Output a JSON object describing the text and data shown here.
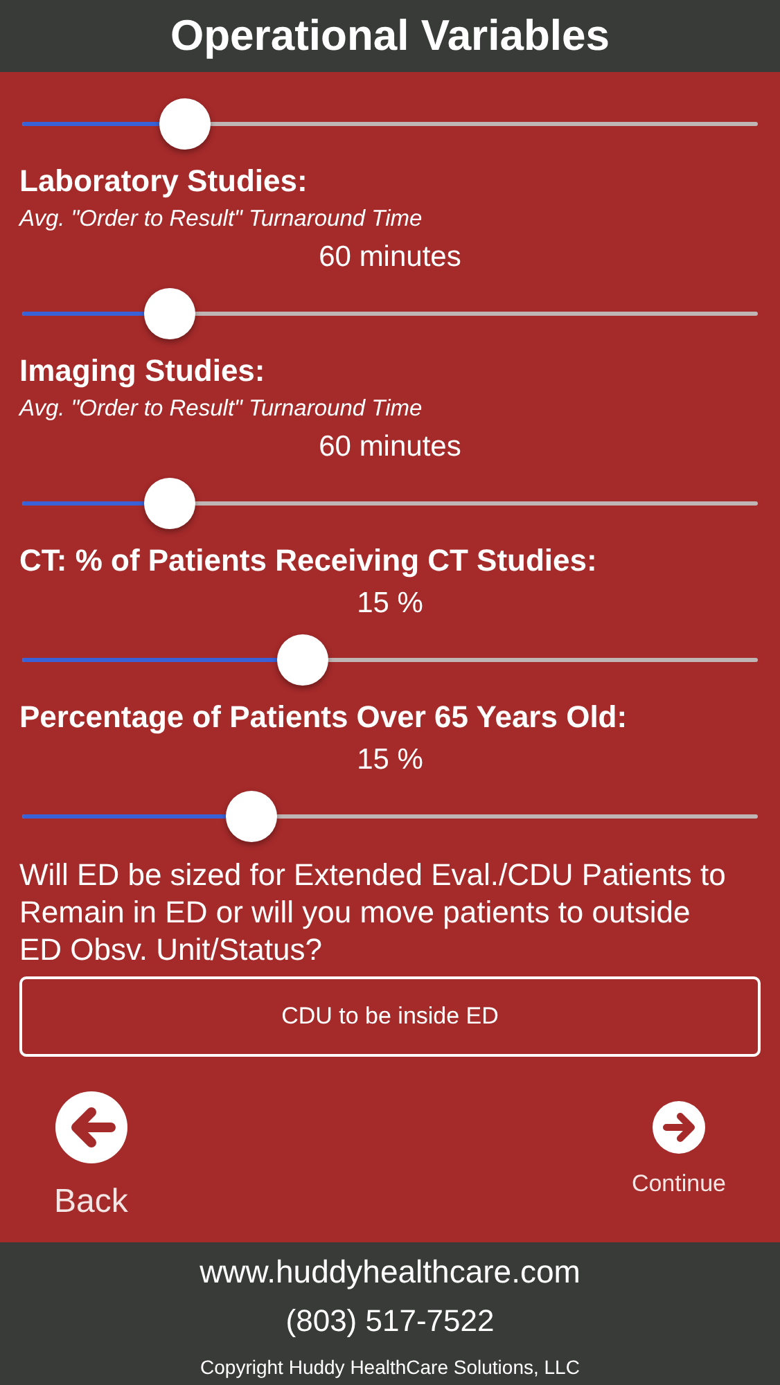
{
  "header": {
    "title": "Operational Variables"
  },
  "sliders": [
    {
      "level": 0.22
    },
    {
      "title": "Laboratory Studies:",
      "subtitle": "Avg. \"Order to Result\" Turnaround Time",
      "value": "60 minutes",
      "level": 0.2
    },
    {
      "title": "Imaging Studies:",
      "subtitle": "Avg. \"Order to Result\" Turnaround Time",
      "value": "60 minutes",
      "level": 0.2
    },
    {
      "title": "CT: % of Patients Receiving CT Studies:",
      "value": "15 %",
      "level": 0.38
    },
    {
      "title": "Percentage of Patients Over 65 Years Old:",
      "value": "15 %",
      "level": 0.31
    }
  ],
  "question": "Will ED be sized for Extended Eval./CDU Patients to Remain in ED or will you move patients to outside ED Obsv. Unit/Status?",
  "choice": "CDU to be inside ED",
  "back": {
    "label": "Back"
  },
  "continue": {
    "label": "Continue"
  },
  "footer": {
    "website": "www.huddyhealthcare.com",
    "phone": "(803) 517-7522",
    "copyright": "Copyright Huddy HealthCare Solutions, LLC"
  }
}
